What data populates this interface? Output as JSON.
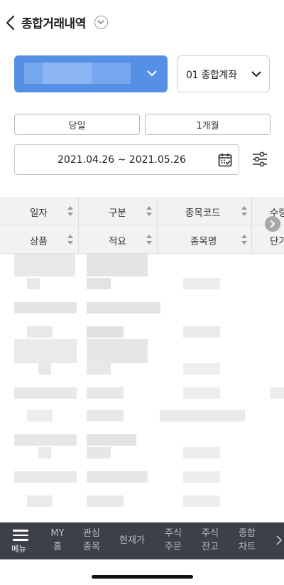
{
  "header": {
    "title": "종합거래내역"
  },
  "account": {
    "selected_account": "",
    "account_type": "01 종합계좌"
  },
  "period": {
    "buttons": [
      "당일",
      "1개월"
    ],
    "date_range": "2021.04.26 ~ 2021.05.26"
  },
  "table": {
    "header_row1": [
      "일자",
      "구분",
      "종목코드",
      "수량"
    ],
    "header_row2": [
      "상품",
      "적요",
      "종목명",
      "단가"
    ]
  },
  "bottom_nav": {
    "menu_label": "메뉴",
    "items": [
      {
        "line1": "MY",
        "line2": "홈"
      },
      {
        "line1": "관심",
        "line2": "종목"
      },
      {
        "line1": "현재가",
        "line2": ""
      },
      {
        "line1": "주식",
        "line2": "주문"
      },
      {
        "line1": "주식",
        "line2": "잔고"
      },
      {
        "line1": "종합",
        "line2": "차트"
      }
    ]
  },
  "colors": {
    "accent": "#5590e6",
    "nav_bg": "#3d4048",
    "table_header_bg": "#f2f2f2"
  },
  "icons": [
    "back-icon",
    "title-dropdown-icon",
    "chevron-down-icon",
    "calendar-icon",
    "filter-settings-icon",
    "scroll-right-icon",
    "hamburger-icon",
    "nav-more-icon"
  ]
}
